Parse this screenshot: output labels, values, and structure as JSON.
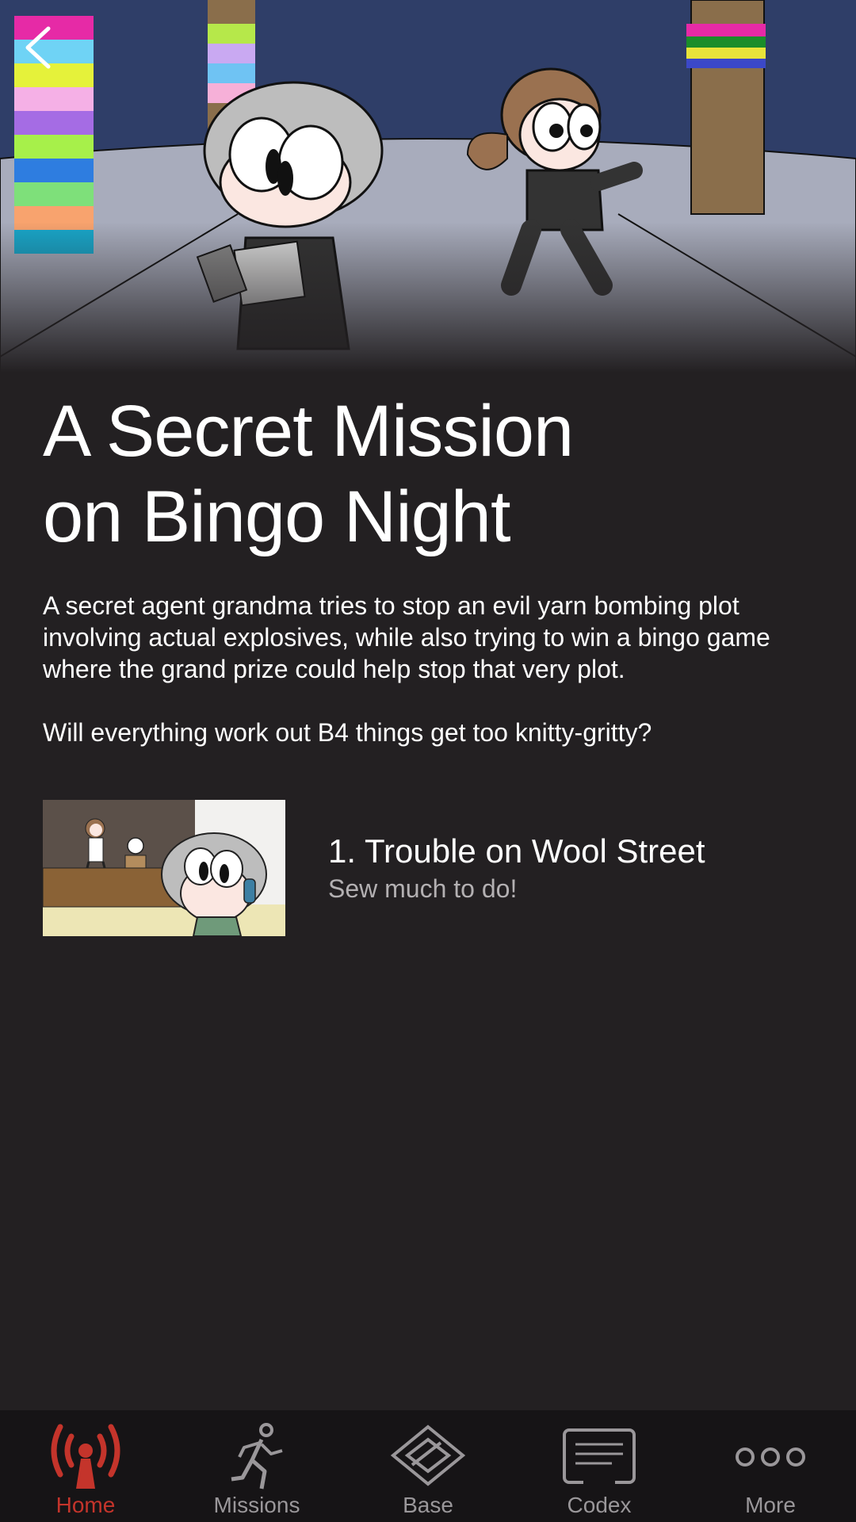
{
  "story": {
    "title_line1": "A Secret Mission",
    "title_line2": "on Bingo Night",
    "description": "A secret agent grandma tries to stop an evil yarn bombing plot involving actual explosives, while also trying to win a bingo game where the grand prize could help stop that very plot.",
    "tagline": "Will everything work out B4 things get too knitty-gritty?"
  },
  "episodes": [
    {
      "title": "1. Trouble on Wool Street",
      "subtitle": "Sew much to do!"
    }
  ],
  "tabbar": {
    "active": "Home",
    "tabs": [
      {
        "label": "Home",
        "icon": "radio-tower-icon"
      },
      {
        "label": "Missions",
        "icon": "running-man-icon"
      },
      {
        "label": "Base",
        "icon": "diamond-icon"
      },
      {
        "label": "Codex",
        "icon": "card-icon"
      },
      {
        "label": "More",
        "icon": "three-dots-icon"
      }
    ]
  },
  "colors": {
    "background": "#232022",
    "tabbar_bg": "#161416",
    "accent": "#c4342b",
    "inactive": "#9a979a"
  }
}
